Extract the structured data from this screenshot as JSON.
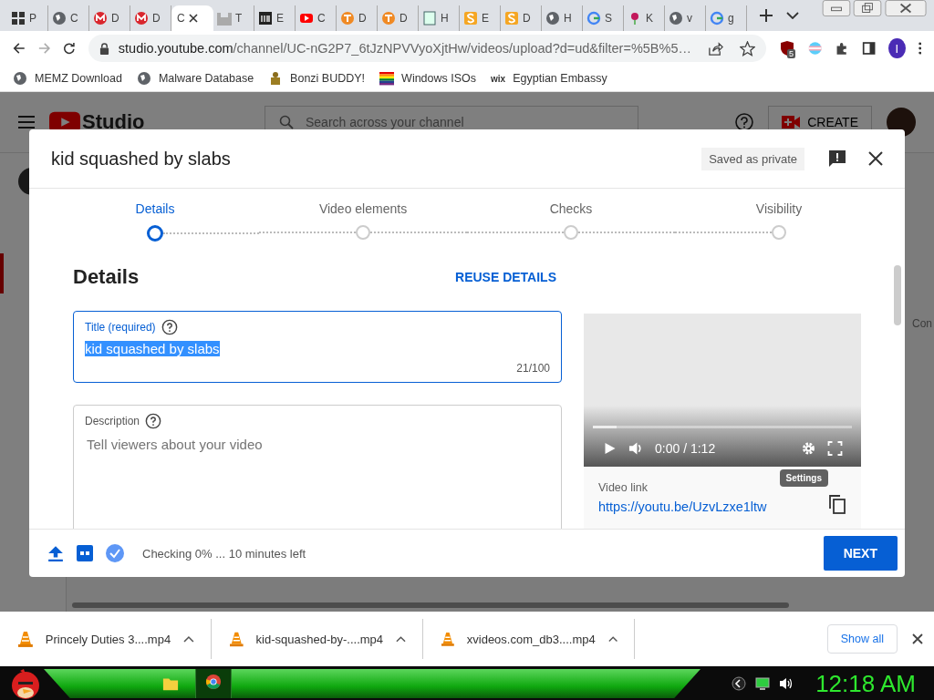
{
  "browser": {
    "tabs": [
      {
        "kind": "letters",
        "label": "P",
        "selected": false
      },
      {
        "kind": "globe",
        "label": "C",
        "selected": false
      },
      {
        "kind": "mega",
        "label": "D",
        "selected": false
      },
      {
        "kind": "mega",
        "label": "D",
        "selected": false
      },
      {
        "kind": "none",
        "label": "C",
        "selected": true
      },
      {
        "kind": "castle",
        "label": "T",
        "selected": false
      },
      {
        "kind": "museum",
        "label": "E",
        "selected": false
      },
      {
        "kind": "youtube",
        "label": "C",
        "selected": false
      },
      {
        "kind": "orange-t",
        "label": "D",
        "selected": false
      },
      {
        "kind": "orange-t",
        "label": "D",
        "selected": false
      },
      {
        "kind": "doc",
        "label": "H",
        "selected": false
      },
      {
        "kind": "orange-s",
        "label": "E",
        "selected": false
      },
      {
        "kind": "orange-s",
        "label": "D",
        "selected": false
      },
      {
        "kind": "globe",
        "label": "H",
        "selected": false
      },
      {
        "kind": "google",
        "label": "S",
        "selected": false
      },
      {
        "kind": "flower",
        "label": "K",
        "selected": false
      },
      {
        "kind": "globe",
        "label": "v",
        "selected": false
      },
      {
        "kind": "google",
        "label": "g",
        "selected": false
      }
    ],
    "url_host": "studio.youtube.com",
    "url_path": "/channel/UC-nG2P7_6tJzNPVVyoXjtHw/videos/upload?d=ud&filter=%5B%5…",
    "extension_badge": "5",
    "profile_initial": "I",
    "bookmarks": [
      {
        "kind": "globe",
        "label": "MEMZ Download"
      },
      {
        "kind": "globe",
        "label": "Malware Database"
      },
      {
        "kind": "figure",
        "label": "Bonzi BUDDY!"
      },
      {
        "kind": "rainbow",
        "label": "Windows ISOs"
      },
      {
        "kind": "wordmark",
        "mark": "wix",
        "label": "Egyptian Embassy"
      }
    ]
  },
  "studio": {
    "logo": "Studio",
    "search_placeholder": "Search across your channel",
    "create_label": "CREATE",
    "side_text": "Con"
  },
  "dialog": {
    "title": "kid squashed by slabs",
    "saved_status": "Saved as private",
    "steps": [
      {
        "label": "Details",
        "selected": true
      },
      {
        "label": "Video elements",
        "selected": false
      },
      {
        "label": "Checks",
        "selected": false
      },
      {
        "label": "Visibility",
        "selected": false
      }
    ],
    "heading": "Details",
    "reuse_button": "REUSE DETAILS",
    "title_field": {
      "label": "Title (required)",
      "value": "kid squashed by slabs",
      "selected": true,
      "count": "21/100"
    },
    "description_field": {
      "label": "Description",
      "placeholder": "Tell viewers about your video"
    },
    "player": {
      "time": "0:00 / 1:12",
      "level": 0.09,
      "tooltip": "Settings"
    },
    "video_link_label": "Video link",
    "video_link": "https://youtu.be/UzvLzxe1ltw",
    "status": "Checking 0% ... 10 minutes left",
    "next_button": "NEXT"
  },
  "downloads": {
    "items": [
      {
        "name": "Princely Duties 3....mp4"
      },
      {
        "name": "kid-squashed-by-....mp4"
      },
      {
        "name": "xvideos.com_db3....mp4"
      }
    ],
    "show_all": "Show all"
  },
  "taskbar": {
    "clock": "12:18 AM"
  }
}
